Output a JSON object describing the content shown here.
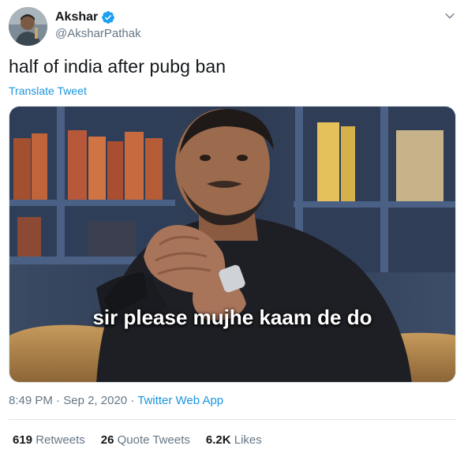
{
  "author": {
    "display_name": "Akshar",
    "handle": "@AksharPathak",
    "verified": true
  },
  "tweet": {
    "text": "half of india after pubg ban",
    "translate_label": "Translate Tweet",
    "media_caption": "sir please mujhe kaam de do",
    "time": "8:49 PM",
    "separator": "·",
    "date": "Sep 2, 2020",
    "source": "Twitter Web App"
  },
  "stats": [
    {
      "count": "619",
      "label": "Retweets"
    },
    {
      "count": "26",
      "label": "Quote Tweets"
    },
    {
      "count": "6.2K",
      "label": "Likes"
    }
  ],
  "icons": {
    "verified": "verified-badge-icon",
    "menu": "chevron-down-icon"
  },
  "colors": {
    "link": "#1b95e0",
    "secondary_text": "#657786",
    "verified": "#1da1f2"
  }
}
